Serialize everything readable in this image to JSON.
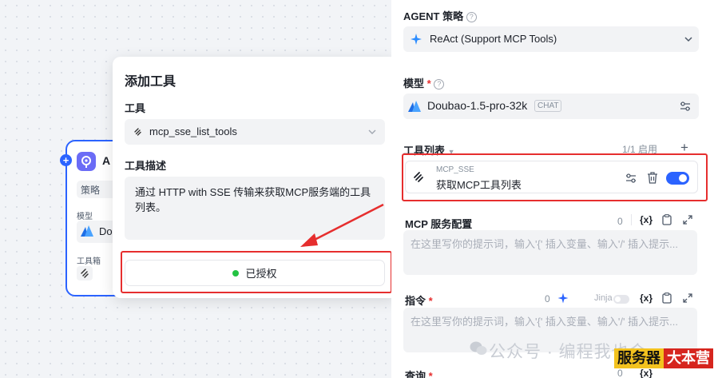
{
  "node": {
    "title": "A",
    "strategy_label": "策略",
    "model_label": "模型",
    "model_value": "Do",
    "toolbox_label": "工具箱"
  },
  "popover": {
    "title": "添加工具",
    "tool_label": "工具",
    "tool_value": "mcp_sse_list_tools",
    "desc_label": "工具描述",
    "desc_text": "通过 HTTP with SSE 传输来获取MCP服务端的工具列表。",
    "auth_label": "已授权",
    "auth_color": "#23c343"
  },
  "panel": {
    "agent_strategy_label": "AGENT 策略",
    "agent_strategy_value": "ReAct (Support MCP Tools)",
    "model_label": "模型",
    "model_value": "Doubao-1.5-pro-32k",
    "model_tag": "CHAT",
    "tools_label": "工具列表",
    "tools_count": "1/1 启用",
    "tool_item": {
      "provider": "MCP_SSE",
      "name": "获取MCP工具列表"
    },
    "mcp_config_label": "MCP 服务配置",
    "mcp_config_count": "0",
    "mcp_config_placeholder": "在这里写你的提示词，输入'{' 插入变量、输入'/' 插入提示...",
    "instruction_label": "指令",
    "instruction_count": "0",
    "jinja_label": "Jinja",
    "instruction_placeholder": "在这里写你的提示词，输入'{' 插入变量、输入'/' 插入提示...",
    "query_label": "查询",
    "var_button": "{x}"
  },
  "watermark": {
    "text": "公众号 · 编程我也会",
    "badge1": "服务器",
    "badge2": "大本营"
  },
  "colors": {
    "accent": "#2b63ff",
    "highlight": "#e62e2e"
  }
}
